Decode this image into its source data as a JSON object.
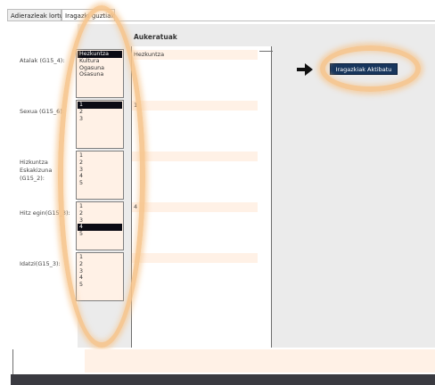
{
  "tabs": [
    {
      "label": "Adierazleak lortu"
    },
    {
      "label": "Iragazki guztiak"
    }
  ],
  "selected_header": "Aukeratuak",
  "filters": [
    {
      "label": "Atalak (G15_4):",
      "options": [
        "Hezkuntza",
        "Kultura",
        "Ogasuna",
        "Osasuna"
      ],
      "selected": "Hezkuntza",
      "selected_display": "Hezkuntza"
    },
    {
      "label": "Sexua (G15_6):",
      "options": [
        "1",
        "2",
        "3"
      ],
      "selected": "1",
      "selected_display": "1"
    },
    {
      "label": "Hizkuntza Eskakizuna (G15_2):",
      "options": [
        "1",
        "2",
        "3",
        "4",
        "5"
      ],
      "selected": "",
      "selected_display": ""
    },
    {
      "label": "Hitz egin(G15_3):",
      "options": [
        "1",
        "2",
        "3",
        "4",
        "5"
      ],
      "selected": "4",
      "selected_display": "4"
    },
    {
      "label": "Idatzi(G15_3):",
      "options": [
        "1",
        "2",
        "3",
        "4",
        "5"
      ],
      "selected": "",
      "selected_display": ""
    }
  ],
  "activate_button": {
    "label": "Iragazkiak Aktibatu"
  },
  "arrow_icon": "right-arrow-icon"
}
